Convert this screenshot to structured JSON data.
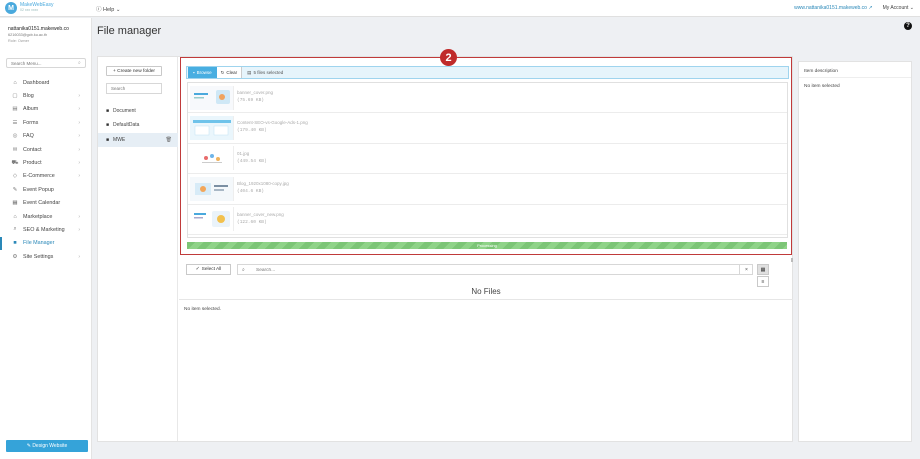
{
  "topbar": {
    "logo_letter": "M",
    "brand_name": "MakeWebEasy",
    "brand_phone": "02 xxx xxxx",
    "help_label": "Help ⌄",
    "site_link": "www.nattanika0151.makeweb.co",
    "my_account": "My Account ⌄"
  },
  "user": {
    "name": "nattanika0151.makeweb.co",
    "email": "6216033@gcb.ku.ac.th",
    "role": "Role: Owner"
  },
  "sidebar": {
    "search_placeholder": "Search Menu...",
    "items": [
      {
        "label": "Dashboard",
        "icon": "⌂"
      },
      {
        "label": "Blog",
        "icon": "▢"
      },
      {
        "label": "Album",
        "icon": "▤"
      },
      {
        "label": "Forms",
        "icon": "☰"
      },
      {
        "label": "FAQ",
        "icon": "◎"
      },
      {
        "label": "Contact",
        "icon": "✉"
      },
      {
        "label": "Product",
        "icon": "⛟"
      },
      {
        "label": "E-Commerce",
        "icon": "◇"
      },
      {
        "label": "Event Popup",
        "icon": "✎"
      },
      {
        "label": "Event Calendar",
        "icon": "▦"
      },
      {
        "label": "Marketplace",
        "icon": "⌂"
      },
      {
        "label": "SEO & Marketing",
        "icon": "⌕"
      },
      {
        "label": "File Manager",
        "icon": "■"
      },
      {
        "label": "Site Settings",
        "icon": "⚙"
      }
    ],
    "design_button": "✎ Design Website"
  },
  "page": {
    "title": "File manager"
  },
  "folders": {
    "new_folder_label": "+ Create new folder",
    "search_placeholder": "Search",
    "items": [
      "Document",
      "DefaultData",
      "MWE"
    ]
  },
  "upload": {
    "step_number": "2",
    "browse_label": "Browse",
    "clear_label": "Clear",
    "files_selected": "5 files selected",
    "progress_label": "Processing",
    "progress_value": 1.0,
    "files": [
      {
        "name": "banner_cover.png",
        "size": "(75.69 KB)"
      },
      {
        "name": "Content-SEO-vs-Google-Ads-1.png",
        "size": "(179.40 KB)"
      },
      {
        "name": "01.jpg",
        "size": "(449.54 KB)"
      },
      {
        "name": "Blog_1920x1080-copy.jpg",
        "size": "(404.6 KB)"
      },
      {
        "name": "banner_cover_new.png",
        "size": "(122.60 KB)"
      }
    ]
  },
  "browser": {
    "select_all": "Select All",
    "search_placeholder": "Search...",
    "clear_x": "×",
    "no_files": "No Files",
    "no_item_selected": "No item selected."
  },
  "description": {
    "title": "Item description",
    "empty": "No item selected"
  },
  "colors": {
    "accent": "#2a88b8",
    "browse_button": "#48aee1",
    "progress_green": "#7cc576",
    "highlight_border": "#c03a3a",
    "badge_red": "#c02b2b"
  }
}
